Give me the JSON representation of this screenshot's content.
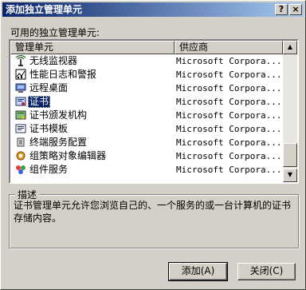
{
  "window": {
    "title": "添加独立管理单元"
  },
  "titlebar_buttons": {
    "help": "?",
    "close": "×"
  },
  "available_label": "可用的独立管理单元:",
  "columns": {
    "name": "管理单元",
    "vendor": "供应商"
  },
  "snapins": [
    {
      "name": "无线监视器",
      "vendor": "Microsoft Corpora...",
      "icon": "wireless-monitor-icon",
      "selected": false
    },
    {
      "name": "性能日志和警报",
      "vendor": "Microsoft Corpora...",
      "icon": "performance-logs-icon",
      "selected": false
    },
    {
      "name": "远程桌面",
      "vendor": "Microsoft Corpora...",
      "icon": "remote-desktop-icon",
      "selected": false
    },
    {
      "name": "证书",
      "vendor": "Microsoft Corpora...",
      "icon": "certificates-icon",
      "selected": true
    },
    {
      "name": "证书颁发机构",
      "vendor": "Microsoft Corpora...",
      "icon": "certificate-authority-icon",
      "selected": false
    },
    {
      "name": "证书模板",
      "vendor": "Microsoft Corpora...",
      "icon": "certificate-templates-icon",
      "selected": false
    },
    {
      "name": "终端服务配置",
      "vendor": "Microsoft Corpora...",
      "icon": "terminal-services-icon",
      "selected": false
    },
    {
      "name": "组策略对象编辑器",
      "vendor": "Microsoft Corpora...",
      "icon": "group-policy-icon",
      "selected": false
    },
    {
      "name": "组件服务",
      "vendor": "Microsoft Corpora...",
      "icon": "component-services-icon",
      "selected": false
    }
  ],
  "description": {
    "legend": "描述",
    "text": "证书管理单元允许您浏览自己的、一个服务的或一台计算机的证书存储内容。"
  },
  "buttons": {
    "add": "添加(A)",
    "close": "关闭(C)"
  },
  "colors": {
    "title_start": "#0a246a",
    "title_end": "#a6caf0",
    "selection": "#0a246a",
    "face": "#d4d0c8"
  }
}
